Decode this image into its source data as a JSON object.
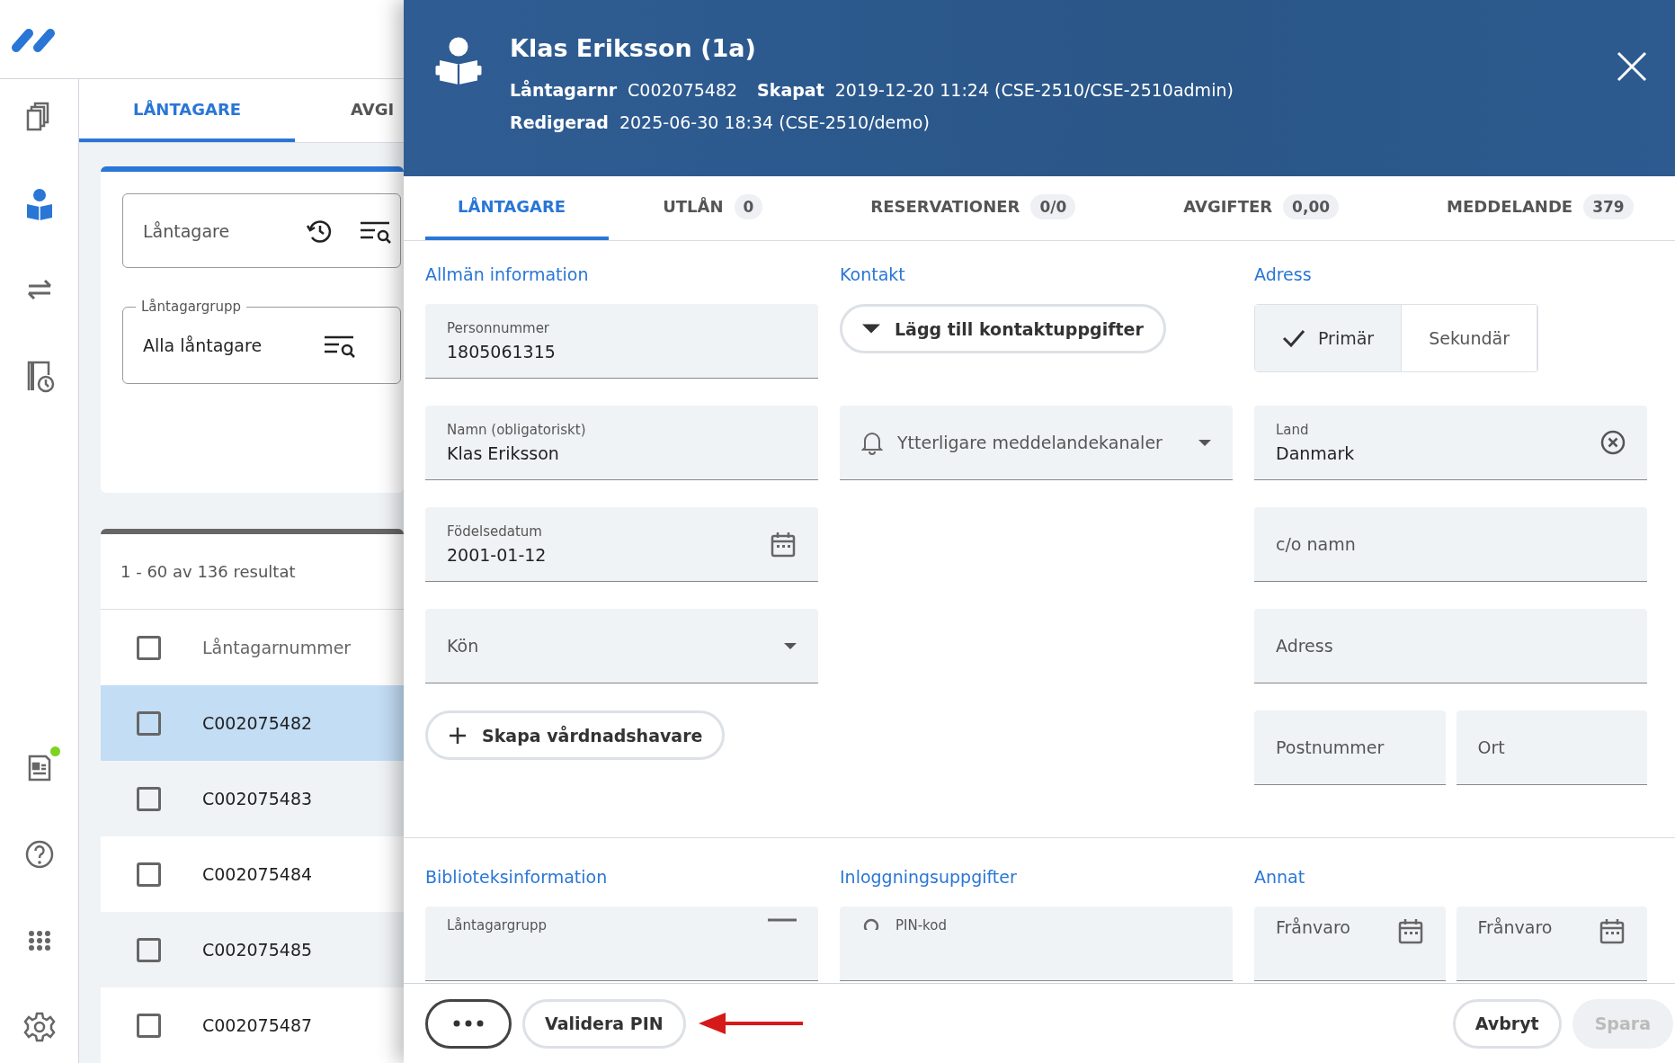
{
  "rail": {
    "items": [
      {
        "selected": false,
        "notification": false
      },
      {
        "selected": true,
        "notification": false
      },
      {
        "selected": false,
        "notification": false
      },
      {
        "selected": false,
        "notification": false
      },
      {
        "selected": false,
        "notification": true
      },
      {
        "selected": false,
        "notification": false
      },
      {
        "selected": false,
        "notification": false
      },
      {
        "selected": false,
        "notification": false
      }
    ]
  },
  "borrower_list": {
    "tabs": [
      {
        "label": "LÅNTAGARE",
        "selected": true
      },
      {
        "label": "AVGI",
        "selected": false
      }
    ],
    "search": {
      "placeholder": "Låntagare"
    },
    "group_filter": {
      "label": "Låntagargrupp",
      "value": "Alla låntagare"
    },
    "results": "1 - 60 av 136 resultat",
    "table": {
      "columns": [
        "Låntagarnummer"
      ],
      "header_checked": false,
      "rows": [
        {
          "id": "C002075482",
          "checked": false,
          "selected": true
        },
        {
          "id": "C002075483",
          "checked": false,
          "selected": false
        },
        {
          "id": "C002075484",
          "checked": false,
          "selected": false
        },
        {
          "id": "C002075485",
          "checked": false,
          "selected": false
        },
        {
          "id": "C002075487",
          "checked": false,
          "selected": false
        }
      ]
    }
  },
  "drawer": {
    "title": "Klas Eriksson (1a)",
    "meta": [
      [
        {
          "label": "Låntagarnr",
          "value": "C002075482"
        },
        {
          "label": "Skapat",
          "value": "2019-12-20 11:24 (CSE-2510/CSE-2510admin)"
        }
      ],
      [
        {
          "label": "Redigerad",
          "value": "2025-06-30 18:34 (CSE-2510/demo)"
        }
      ]
    ],
    "tabs": [
      {
        "label": "LÅNTAGARE",
        "selected": true
      },
      {
        "label": "UTLÅN",
        "count": "0",
        "selected": false
      },
      {
        "label": "RESERVATIONER",
        "count": "0/0",
        "selected": false
      },
      {
        "label": "AVGIFTER",
        "count": "0,00",
        "selected": false
      },
      {
        "label": "MEDDELANDE",
        "count": "379",
        "selected": false
      }
    ],
    "sections": [
      {
        "title": "Allmän information",
        "items": [
          {
            "kind": "text",
            "label": "Personnummer",
            "value": "1805061315"
          },
          {
            "kind": "text",
            "label": "Namn (obligatoriskt)",
            "value": "Klas Eriksson"
          },
          {
            "kind": "date",
            "label": "Födelsedatum",
            "value": "2001-01-12"
          },
          {
            "kind": "select",
            "placeholder": "Kön"
          },
          {
            "kind": "action",
            "label": "Skapa vårdnadshavare"
          }
        ]
      },
      {
        "title": "Kontakt",
        "items": [
          {
            "kind": "dropdown_button",
            "label": "Lägg till kontaktuppgifter"
          },
          {
            "kind": "channel_select",
            "placeholder": "Ytterligare meddelandekanaler"
          }
        ]
      },
      {
        "title": "Adress",
        "items": [
          {
            "kind": "segmented",
            "options": [
              {
                "label": "Primär",
                "selected": true
              },
              {
                "label": "Sekundär",
                "selected": false
              }
            ]
          },
          {
            "kind": "clearable",
            "label": "Land",
            "value": "Danmark"
          },
          {
            "kind": "text",
            "placeholder": "c/o namn"
          },
          {
            "kind": "text",
            "placeholder": "Adress"
          },
          {
            "kind": "pair",
            "fields": [
              {
                "placeholder": "Postnummer"
              },
              {
                "placeholder": "Ort"
              }
            ]
          }
        ]
      }
    ],
    "lower_sections": [
      {
        "title": "Biblioteksinformation",
        "items": [
          {
            "kind": "lookup",
            "label": "Låntagargrupp"
          }
        ]
      },
      {
        "title": "Inloggningsuppgifter",
        "items": [
          {
            "kind": "pin",
            "label": "PIN-kod"
          }
        ]
      },
      {
        "title": "Annat",
        "items": [
          {
            "kind": "date_pair",
            "fields": [
              {
                "placeholder": "Frånvaro"
              },
              {
                "placeholder": "Frånvaro"
              }
            ]
          }
        ]
      }
    ],
    "footer": {
      "left": [
        {
          "kind": "more",
          "disabled": false
        },
        {
          "kind": "outline",
          "label": "Validera PIN",
          "disabled": false
        }
      ],
      "pointer_arrow": true,
      "right": [
        {
          "kind": "outline",
          "label": "Avbryt",
          "disabled": false
        },
        {
          "kind": "filled",
          "label": "Spara",
          "disabled": true
        }
      ]
    }
  }
}
